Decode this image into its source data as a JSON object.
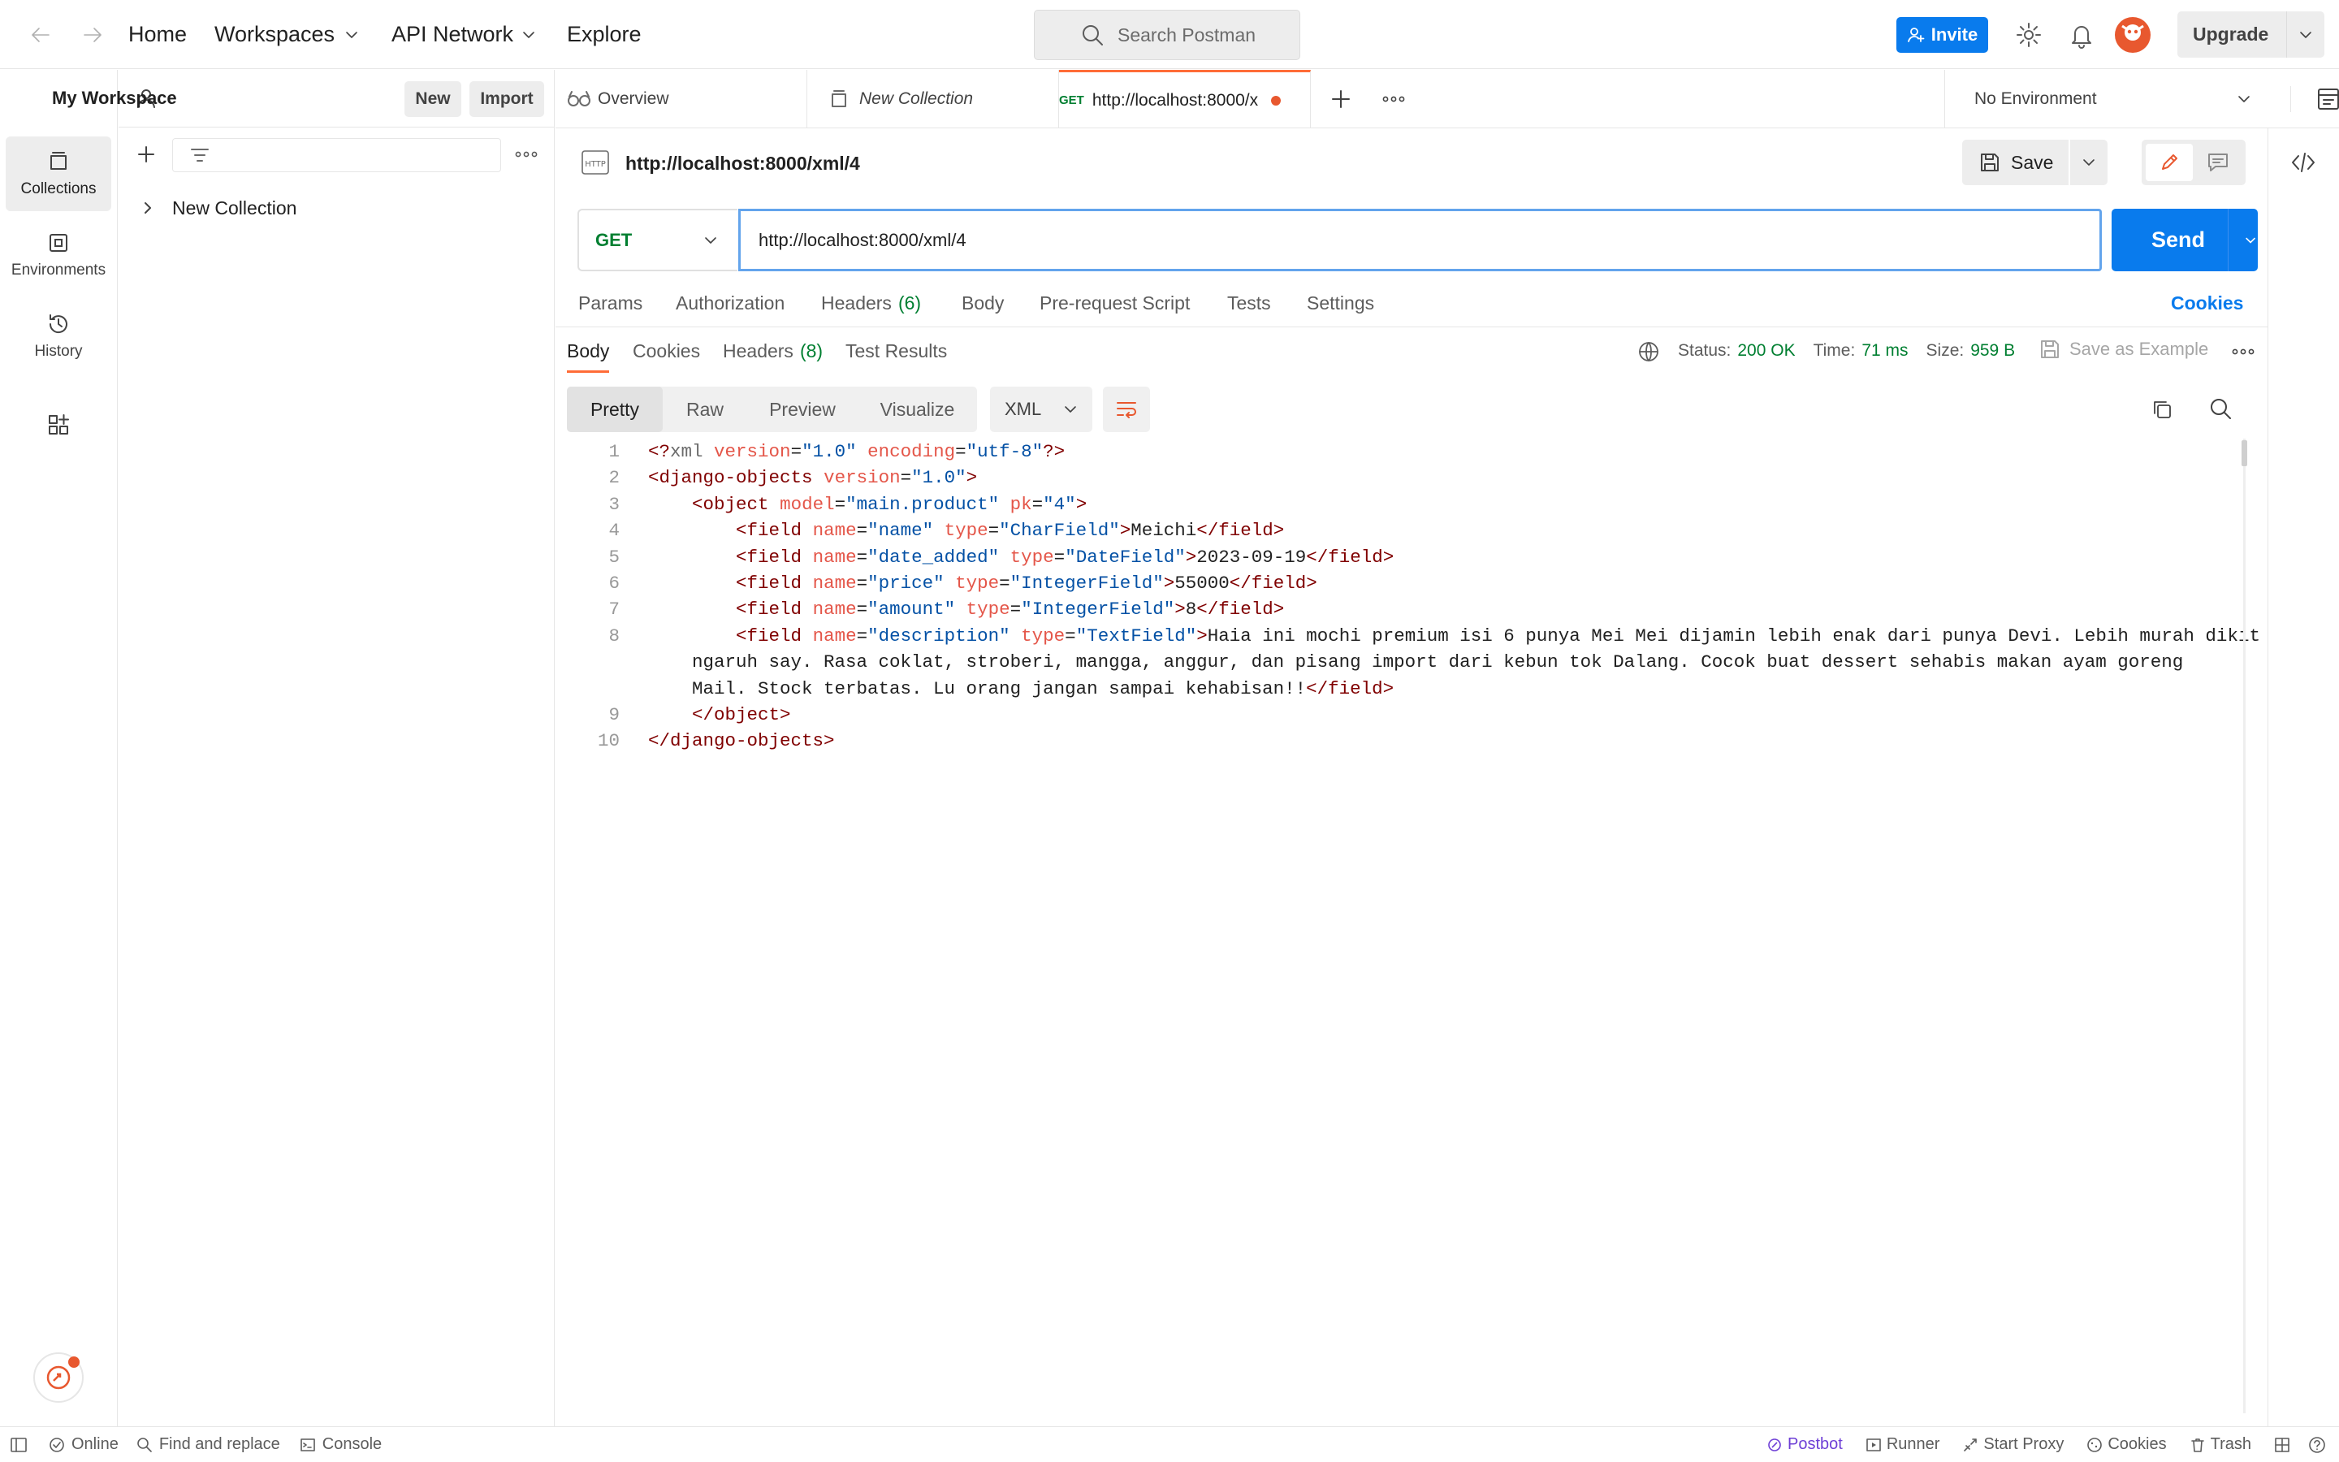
{
  "header": {
    "nav": [
      "Home",
      "Workspaces",
      "API Network",
      "Explore"
    ],
    "search_placeholder": "Search Postman",
    "invite_label": "Invite",
    "upgrade_label": "Upgrade"
  },
  "rail": {
    "items": [
      "Collections",
      "Environments",
      "History"
    ]
  },
  "sidebar": {
    "workspace": "My Workspace",
    "new_label": "New",
    "import_label": "Import",
    "collection": "New Collection"
  },
  "tabs": {
    "overview": "Overview",
    "collection": "New Collection",
    "request_method": "GET",
    "request_url": "http://localhost:8000/x",
    "environment": "No Environment"
  },
  "request": {
    "title": "http://localhost:8000/xml/4",
    "save_label": "Save",
    "method": "GET",
    "url": "http://localhost:8000/xml/4",
    "send_label": "Send",
    "subtabs": [
      "Params",
      "Authorization",
      "Headers",
      "Body",
      "Pre-request Script",
      "Tests",
      "Settings"
    ],
    "headers_count": "(6)",
    "cookies_label": "Cookies"
  },
  "response": {
    "tabs": [
      "Body",
      "Cookies",
      "Headers",
      "Test Results"
    ],
    "headers_count": "(8)",
    "status_label": "Status:",
    "status_value": "200 OK",
    "time_label": "Time:",
    "time_value": "71 ms",
    "size_label": "Size:",
    "size_value": "959 B",
    "save_example": "Save as Example",
    "views": [
      "Pretty",
      "Raw",
      "Preview",
      "Visualize"
    ],
    "format": "XML",
    "line_numbers": [
      "1",
      "2",
      "3",
      "4",
      "5",
      "6",
      "7",
      "8",
      "9",
      "10"
    ],
    "code": {
      "l1_decl": "xml",
      "l1_a1": "version",
      "l1_v1": "\"1.0\"",
      "l1_a2": "encoding",
      "l1_v2": "\"utf-8\"",
      "root": "django-objects",
      "root_attr": "version",
      "root_val": "\"1.0\"",
      "obj": "object",
      "obj_a1": "model",
      "obj_v1": "\"main.product\"",
      "obj_a2": "pk",
      "obj_v2": "\"4\"",
      "field": "field",
      "attr_name": "name",
      "attr_type": "type",
      "f1_name": "\"name\"",
      "f1_type": "\"CharField\"",
      "f1_text": "Meichi",
      "f2_name": "\"date_added\"",
      "f2_type": "\"DateField\"",
      "f2_text": "2023-09-19",
      "f3_name": "\"price\"",
      "f3_type": "\"IntegerField\"",
      "f3_text": "55000",
      "f4_name": "\"amount\"",
      "f4_type": "\"IntegerField\"",
      "f4_text": "8",
      "f5_name": "\"description\"",
      "f5_type": "\"TextField\"",
      "f5_text_1": "Haia ini mochi premium isi 6 punya Mei Mei dijamin lebih enak dari punya Devi. Lebih murah dikit",
      "f5_text_2": "ngaruh say. Rasa coklat, stroberi, mangga, anggur, dan pisang import dari kebun tok Dalang. Cocok buat dessert sehabis makan ayam goreng",
      "f5_text_3": "Mail. Stock terbatas. Lu orang jangan sampai kehabisan!!"
    }
  },
  "statusbar": {
    "online": "Online",
    "find_replace": "Find and replace",
    "console": "Console",
    "postbot": "Postbot",
    "runner": "Runner",
    "start_proxy": "Start Proxy",
    "cookies": "Cookies",
    "trash": "Trash"
  },
  "colors": {
    "accent": "#097bed",
    "tab_active": "#ff6c37",
    "success": "#007f31"
  }
}
